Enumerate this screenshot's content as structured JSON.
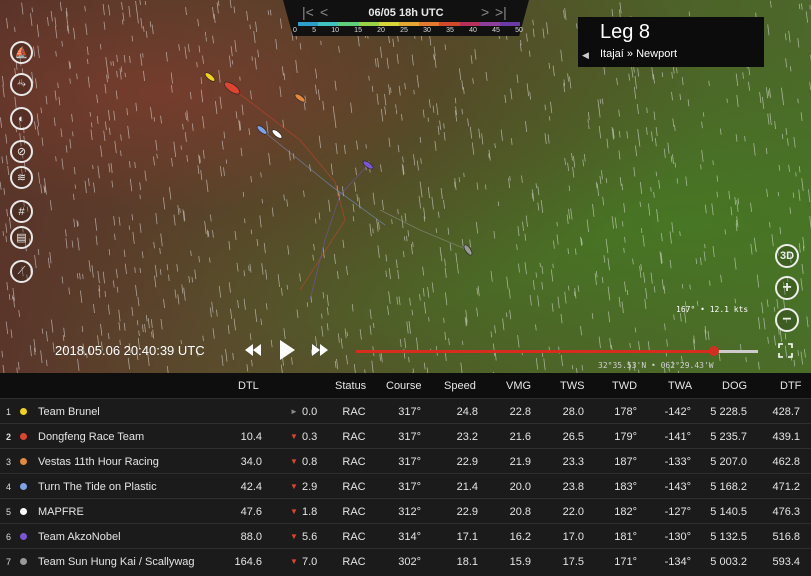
{
  "timebar": {
    "date": "06/05 18h UTC",
    "nav_first": "|<",
    "nav_prev": "<",
    "nav_next": ">",
    "nav_last": ">|",
    "scale_labels": [
      "0",
      "5",
      "10",
      "15",
      "20",
      "25",
      "30",
      "35",
      "40",
      "45",
      "50"
    ],
    "scale_colors": [
      "#2c9ec9",
      "#3fc2c2",
      "#5fcf7a",
      "#9bd24a",
      "#d9d43a",
      "#e6a634",
      "#e37a2f",
      "#d24a2b",
      "#b8305a",
      "#8d3f9c",
      "#6b3aa6"
    ]
  },
  "leg": {
    "title": "Leg 8",
    "route": "Itajaí » Newport",
    "caret": "◀"
  },
  "tools": [
    "book-icon",
    "link-icon",
    "route-icon",
    "compass-icon",
    "wind-icon",
    "grid-icon",
    "ruler-icon",
    "chart-icon"
  ],
  "tool_glyphs": [
    "⛵",
    "⤳",
    "◐",
    "⊘",
    "≋",
    "#",
    "▤",
    "⟋"
  ],
  "right_controls": {
    "threed": "3D",
    "zoom_in": "+",
    "zoom_out": "−"
  },
  "wind_readout": "167° • 12.1 kts",
  "coords": "32°35.53'N • 062°29.43'W",
  "playback": {
    "datetime": "2018.05.06 20:40:39 UTC",
    "progress": 0.89
  },
  "table": {
    "headers": [
      "DTL",
      "Status",
      "Course",
      "Speed",
      "VMG",
      "TWS",
      "TWD",
      "TWA",
      "DOG",
      "DTF"
    ],
    "rows": [
      {
        "rank": "1",
        "bold": false,
        "color": "#f2d21b",
        "team": "Team Brunel",
        "dtl": "",
        "delta_sym": "►",
        "delta_color": "#888888",
        "delta": "0.0",
        "status": "RAC",
        "course": "317°",
        "speed": "24.8",
        "vmg": "22.8",
        "tws": "28.0",
        "twd": "178°",
        "twa": "-142°",
        "dog": "5 228.5",
        "dtf": "428.7"
      },
      {
        "rank": "2",
        "bold": true,
        "color": "#e0432f",
        "team": "Dongfeng Race Team",
        "dtl": "10.4",
        "delta_sym": "▼",
        "delta_color": "#e0432f",
        "delta": "0.3",
        "status": "RAC",
        "course": "317°",
        "speed": "23.2",
        "vmg": "21.6",
        "tws": "26.5",
        "twd": "179°",
        "twa": "-141°",
        "dog": "5 235.7",
        "dtf": "439.1"
      },
      {
        "rank": "3",
        "bold": false,
        "color": "#e58a3a",
        "team": "Vestas 11th Hour Racing",
        "dtl": "34.0",
        "delta_sym": "▼",
        "delta_color": "#e0432f",
        "delta": "0.8",
        "status": "RAC",
        "course": "317°",
        "speed": "22.9",
        "vmg": "21.9",
        "tws": "23.3",
        "twd": "187°",
        "twa": "-133°",
        "dog": "5 207.0",
        "dtf": "462.8"
      },
      {
        "rank": "4",
        "bold": false,
        "color": "#7fa1e8",
        "team": "Turn The Tide on Plastic",
        "dtl": "42.4",
        "delta_sym": "▼",
        "delta_color": "#e0432f",
        "delta": "2.9",
        "status": "RAC",
        "course": "317°",
        "speed": "21.4",
        "vmg": "20.0",
        "tws": "23.8",
        "twd": "183°",
        "twa": "-143°",
        "dog": "5 168.2",
        "dtf": "471.2"
      },
      {
        "rank": "5",
        "bold": false,
        "color": "#ffffff",
        "team": "MAPFRE",
        "dtl": "47.6",
        "delta_sym": "▼",
        "delta_color": "#e0432f",
        "delta": "1.8",
        "status": "RAC",
        "course": "312°",
        "speed": "22.9",
        "vmg": "20.8",
        "tws": "22.0",
        "twd": "182°",
        "twa": "-127°",
        "dog": "5 140.5",
        "dtf": "476.3"
      },
      {
        "rank": "6",
        "bold": false,
        "color": "#7a55d6",
        "team": "Team AkzoNobel",
        "dtl": "88.0",
        "delta_sym": "▼",
        "delta_color": "#e0432f",
        "delta": "5.6",
        "status": "RAC",
        "course": "314°",
        "speed": "17.1",
        "vmg": "16.2",
        "tws": "17.0",
        "twd": "181°",
        "twa": "-130°",
        "dog": "5 132.5",
        "dtf": "516.8"
      },
      {
        "rank": "7",
        "bold": false,
        "color": "#9a9a9a",
        "team": "Team Sun Hung Kai / Scallywag",
        "dtl": "164.6",
        "delta_sym": "▼",
        "delta_color": "#e0432f",
        "delta": "7.0",
        "status": "RAC",
        "course": "302°",
        "speed": "18.1",
        "vmg": "15.9",
        "tws": "17.5",
        "twd": "171°",
        "twa": "-134°",
        "dog": "5 003.2",
        "dtf": "593.4"
      }
    ]
  }
}
